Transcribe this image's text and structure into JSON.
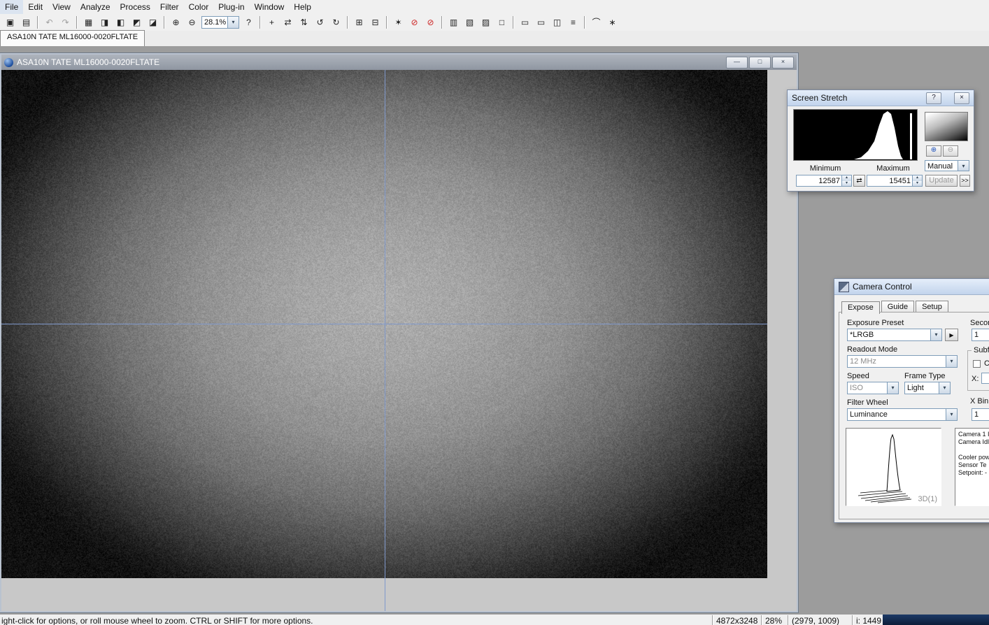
{
  "colors": {
    "crosshair": "#8099cc",
    "dark_overlay": "#10233f"
  },
  "glyphs": {
    "dropdown": "▾",
    "spin_up": "▴",
    "spin_down": "▾"
  },
  "menu": {
    "items": [
      "File",
      "Edit",
      "View",
      "Analyze",
      "Process",
      "Filter",
      "Color",
      "Plug-in",
      "Window",
      "Help"
    ]
  },
  "toolbar": {
    "zoom_value": "28.1%",
    "items": [
      {
        "name": "open-icon",
        "glyph": "▣"
      },
      {
        "name": "save-icon",
        "glyph": "▤"
      },
      {
        "sep": true
      },
      {
        "name": "undo-icon",
        "glyph": "↶",
        "disabled": true
      },
      {
        "name": "redo-icon",
        "glyph": "↷",
        "disabled": true
      },
      {
        "sep": true
      },
      {
        "name": "screen-stretch-icon",
        "glyph": "▦"
      },
      {
        "name": "information-window-icon",
        "glyph": "◨"
      },
      {
        "name": "magnify-window-icon",
        "glyph": "◧"
      },
      {
        "name": "night-vision-icon",
        "glyph": "◩"
      },
      {
        "name": "command-sequence-icon",
        "glyph": "◪"
      },
      {
        "sep": true
      },
      {
        "name": "zoom-in-icon",
        "glyph": "⊕"
      },
      {
        "name": "zoom-out-icon",
        "glyph": "⊖"
      },
      {
        "zoom": true
      },
      {
        "name": "context-help-icon",
        "glyph": "?"
      },
      {
        "sep": true
      },
      {
        "name": "toggle-crosshairs-icon",
        "glyph": "+"
      },
      {
        "name": "flip-horizontal-icon",
        "glyph": "⇄"
      },
      {
        "name": "flip-vertical-icon",
        "glyph": "⇅"
      },
      {
        "name": "rotate-left-icon",
        "glyph": "↺"
      },
      {
        "name": "rotate-right-icon",
        "glyph": "↻"
      },
      {
        "sep": true
      },
      {
        "name": "duplicate-icon",
        "glyph": "⊞"
      },
      {
        "name": "new-window-icon",
        "glyph": "⊟"
      },
      {
        "sep": true
      },
      {
        "name": "photometry-icon",
        "glyph": "✶"
      },
      {
        "name": "calibration-off-icon",
        "glyph": "⊘",
        "red": true
      },
      {
        "name": "color-off-icon",
        "glyph": "⊘",
        "red": true
      },
      {
        "sep": true
      },
      {
        "name": "graph-window-icon",
        "glyph": "▥"
      },
      {
        "name": "batch-files-icon",
        "glyph": "▧"
      },
      {
        "name": "stack-icon",
        "glyph": "▨"
      },
      {
        "name": "subframe-icon",
        "glyph": "□"
      },
      {
        "sep": true
      },
      {
        "name": "image-tile-icon",
        "glyph": "▭"
      },
      {
        "name": "image-tile2-icon",
        "glyph": "▭"
      },
      {
        "name": "mask-icon",
        "glyph": "◫"
      },
      {
        "name": "collapse-icon",
        "glyph": "≡"
      },
      {
        "sep": true
      },
      {
        "name": "line-profile-icon",
        "glyph": "⌒"
      },
      {
        "name": "asterisk-settings-icon",
        "glyph": "∗"
      }
    ]
  },
  "tab_bar": {
    "document_tab": "ASA10N TATE ML16000-0020FLTATE"
  },
  "image_window": {
    "title": "ASA10N TATE ML16000-0020FLTATE",
    "minimize_glyph": "—",
    "restore_glyph": "□",
    "close_glyph": "×"
  },
  "screen_stretch": {
    "title": "Screen Stretch",
    "help_glyph": "?",
    "close_glyph": "×",
    "zoom_in_glyph": "⊕",
    "zoom_out_glyph": "⊖",
    "mode_value": "Manual",
    "minimum_label": "Minimum",
    "maximum_label": "Maximum",
    "minimum_value": "12587",
    "maximum_value": "15451",
    "swap_glyph": "⇄",
    "update_label": "Update",
    "expand_label": ">>"
  },
  "camera_control": {
    "title": "Camera Control",
    "tabs": [
      "Expose",
      "Guide",
      "Setup"
    ],
    "exposure_preset_label": "Exposure Preset",
    "exposure_preset_value": "*LRGB",
    "start_glyph": "▶",
    "seconds_label": "Secon",
    "seconds_value": "1",
    "readout_mode_label": "Readout Mode",
    "readout_mode_value": "12 MHz",
    "subframe_label": "Subf",
    "subframe_option_label": "C",
    "x_field_label": "X:",
    "speed_label": "Speed",
    "speed_value": "ISO",
    "frame_type_label": "Frame Type",
    "frame_type_value": "Light",
    "filter_wheel_label": "Filter Wheel",
    "filter_wheel_value": "Luminance",
    "x_binning_label": "X Binn",
    "x_binning_value": "1",
    "graph_label": "3D(1)",
    "status_lines": [
      "Camera 1 I",
      "Camera Idl",
      "",
      "Cooler pow",
      "Sensor Te",
      "Setpoint: -"
    ]
  },
  "status_bar": {
    "hint": "ight-click for options, or roll mouse wheel to zoom. CTRL or SHIFT for more options.",
    "image_size": "4872x3248",
    "zoom": "28%",
    "coordinates": "(2979, 1009)",
    "intensity": "i: 1449"
  }
}
